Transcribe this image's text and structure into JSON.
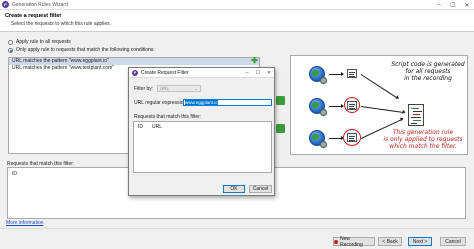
{
  "window": {
    "title": "Generation Rules Wizard",
    "controls": {
      "minimize": "–",
      "maximize": "☐",
      "close": "✕"
    }
  },
  "header": {
    "title": "Create a request filter",
    "subtitle": "Select the requests to which this rule applies."
  },
  "options": {
    "apply_all": "Apply rule to all requests",
    "apply_matching": "Only apply rule to requests that match the following conditions:",
    "selected": "apply_matching"
  },
  "conditions": [
    "URL matches the pattern \"www.eggplant.io\"",
    "URL matches the pattern \"www.testplant.com\""
  ],
  "diagram": {
    "note_all": [
      "Script code is generated",
      "for all requests",
      "in the recording"
    ],
    "note_filtered": [
      "This generation rule",
      "is only applied to requests",
      "which match the filter."
    ]
  },
  "requests_panel": {
    "label": "Requests that match this filter:",
    "column": "ID"
  },
  "more_info": "More information",
  "footer": {
    "new_recording": "New Recording",
    "back": "< Back",
    "next": "Next >",
    "cancel": "Cancel"
  },
  "dialog": {
    "title": "Create Request Filter",
    "filter_by_label": "Filter by:",
    "filter_by_value": "URL",
    "regex_label": "URL regular expression:",
    "regex_value": "www.eggplant.io",
    "matches_label": "Requests that match this filter:",
    "columns": [
      "ID",
      "URL"
    ],
    "ok": "OK",
    "cancel": "Cancel",
    "controls": {
      "minimize": "–",
      "maximize": "☐",
      "close": "✕"
    }
  }
}
